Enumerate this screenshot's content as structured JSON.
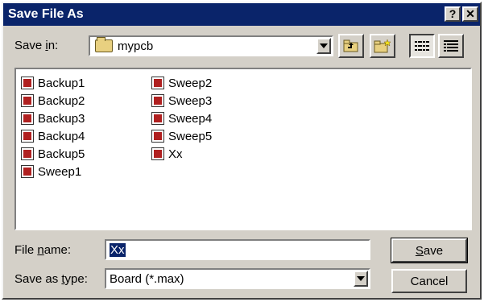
{
  "window": {
    "title": "Save File As",
    "help_button": "?",
    "close_button": "✕"
  },
  "save_in": {
    "label_prefix": "Save ",
    "label_accel": "i",
    "label_suffix": "n:",
    "value": "mypcb"
  },
  "files": {
    "column1": [
      "Backup1",
      "Backup2",
      "Backup3",
      "Backup4",
      "Backup5",
      "Sweep1"
    ],
    "column2": [
      "Sweep2",
      "Sweep3",
      "Sweep4",
      "Sweep5",
      "Xx"
    ]
  },
  "file_name": {
    "label_prefix": "File ",
    "label_accel": "n",
    "label_suffix": "ame:",
    "value": "Xx"
  },
  "save_as_type": {
    "label_prefix": "Save as ",
    "label_accel": "t",
    "label_suffix": "ype:",
    "value": "Board (*.max)"
  },
  "buttons": {
    "save_accel": "S",
    "save_rest": "ave",
    "cancel": "Cancel"
  },
  "icons": {
    "up_folder": "up-folder-icon",
    "new_folder": "new-folder-icon",
    "list_view": "list-view-icon",
    "details_view": "details-view-icon"
  }
}
